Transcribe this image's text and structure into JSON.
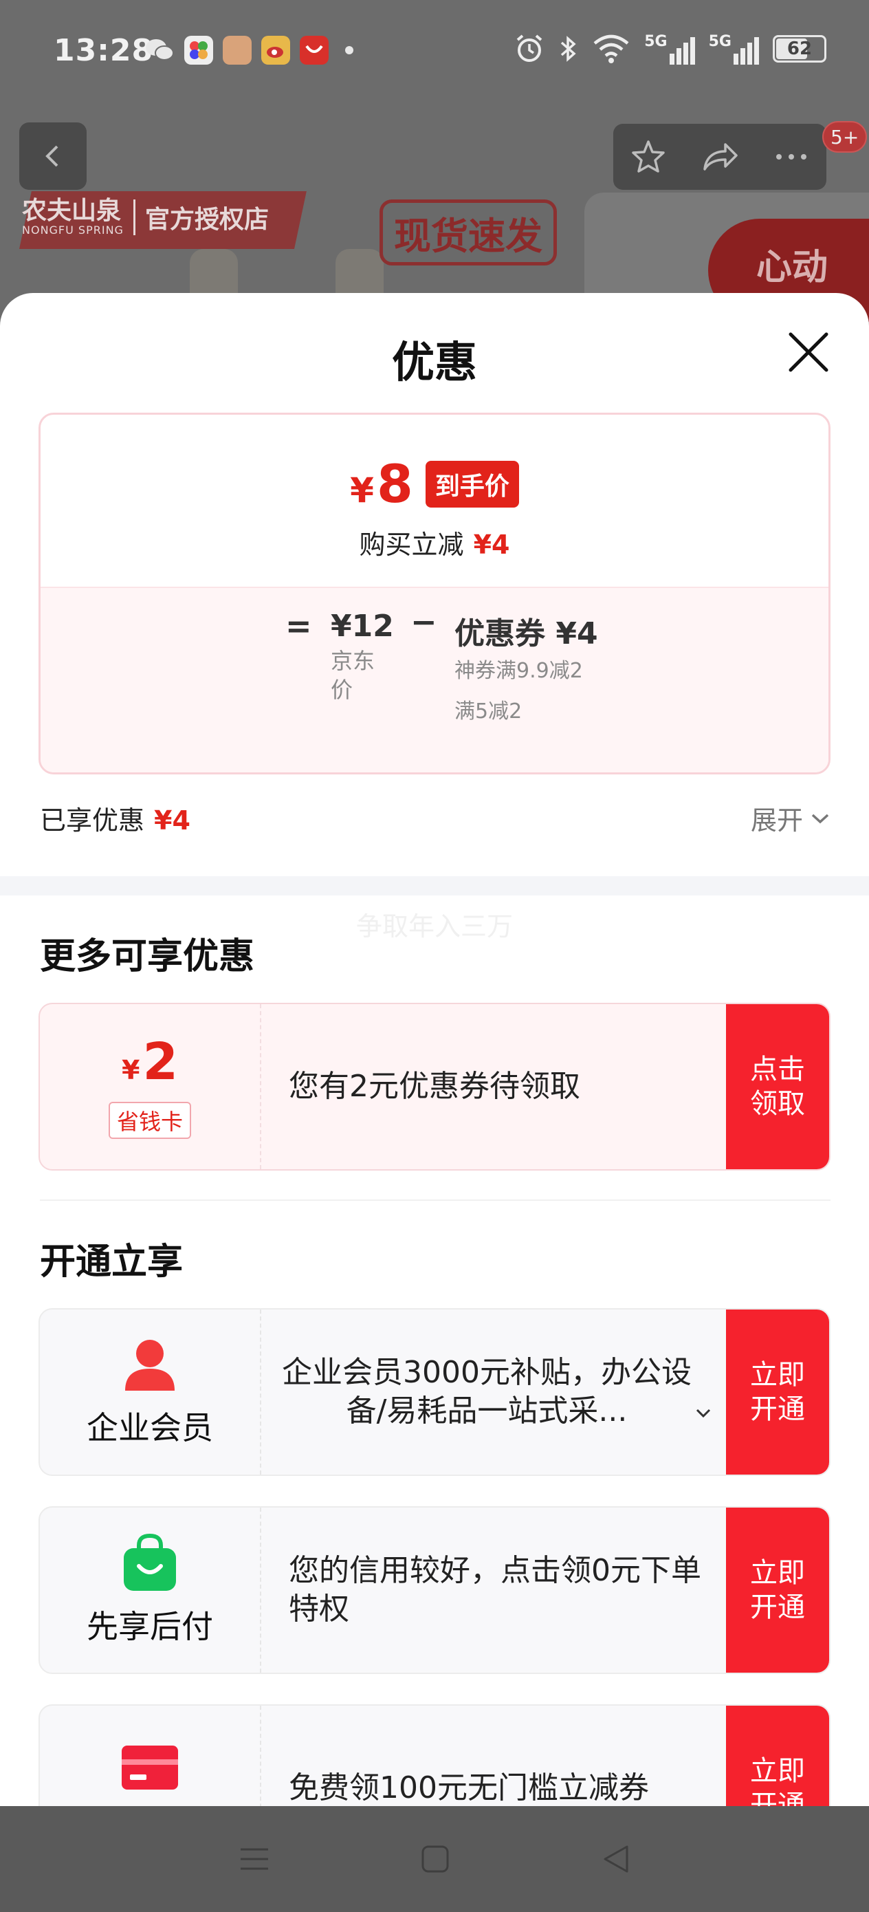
{
  "status_bar": {
    "time": "13:28",
    "battery": "62",
    "network_1": "5G",
    "network_2": "5G"
  },
  "background": {
    "brand": "农夫山泉",
    "brand_en": "NONGFU SPRING",
    "authorized": "官方授权店",
    "stamp": "现货速发",
    "promo": "心动",
    "badge": "5+"
  },
  "sheet": {
    "title": "优惠",
    "price": {
      "currency": "¥",
      "amount": "8",
      "tag": "到手价",
      "cut_label": "购买立减",
      "cut_value": "¥4"
    },
    "breakdown": {
      "equals": "=",
      "minus": "−",
      "jd_value": "¥12",
      "jd_label": "京东价",
      "coupon_label": "优惠券",
      "coupon_value": "¥4",
      "coupon_rule_1": "神券满9.9减2",
      "coupon_rule_2": "满5减2"
    },
    "enjoyed_label": "已享优惠",
    "enjoyed_value": "¥4",
    "expand_label": "展开",
    "ghost_text": "争取年入三万"
  },
  "more_offers": {
    "title": "更多可享优惠",
    "card": {
      "currency": "¥",
      "amount": "2",
      "tag": "省钱卡",
      "description": "您有2元优惠券待领取",
      "button": "点击领取"
    }
  },
  "membership": {
    "title": "开通立享",
    "items": [
      {
        "name": "企业会员",
        "description": "企业会员3000元补贴，办公设备/易耗品一站式采...",
        "button": "立即开通",
        "icon": "person-icon",
        "icon_color": "#f23b3b"
      },
      {
        "name": "先享后付",
        "description": "您的信用较好，点击领0元下单特权",
        "button": "立即开通",
        "icon": "shopping-bag-icon",
        "icon_color": "#17c35c"
      },
      {
        "name": "",
        "description": "免费领100元无门槛立减券",
        "button": "立即开通",
        "icon": "card-icon",
        "icon_color": "#f0213a"
      }
    ]
  },
  "colors": {
    "accent_red": "#e2231a",
    "button_red": "#f5222d"
  }
}
